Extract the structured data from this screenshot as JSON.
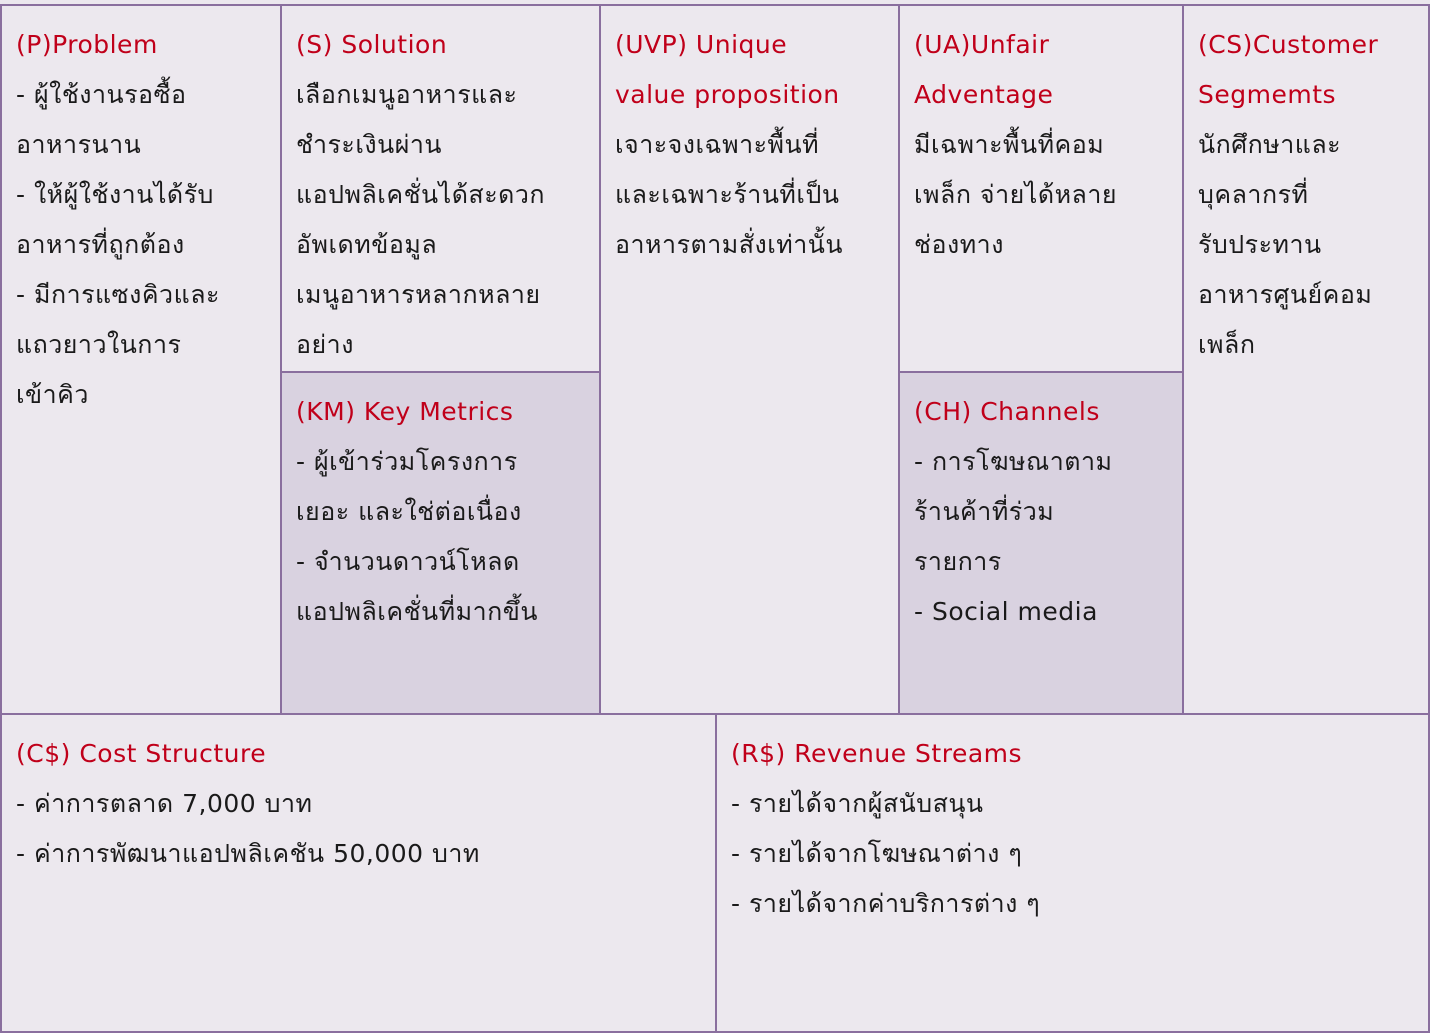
{
  "problem": {
    "title": "(P)Problem",
    "lines": [
      "- ผู้ใช้งานรอซื้อ",
      "อาหารนาน",
      "- ให้ผู้ใช้งานได้รับ",
      "อาหารที่ถูกต้อง",
      "- มีการแซงคิวและ",
      "แถวยาวในการ",
      "เข้าคิว"
    ]
  },
  "solution": {
    "title": "(S) Solution",
    "lines": [
      "เลือกเมนูอาหารและ",
      "ชำระเงินผ่าน",
      "แอปพลิเคชั่นได้สะดวก",
      "อัพเดทข้อมูล",
      "เมนูอาหารหลากหลาย",
      "อย่าง"
    ]
  },
  "key_metrics": {
    "title": "(KM) Key Metrics",
    "lines": [
      "- ผู้เข้าร่วมโครงการ",
      "เยอะ และใช่ต่อเนื่อง",
      "- จำนวนดาวน์โหลด",
      "แอปพลิเคชั่นที่มากขึ้น"
    ]
  },
  "uvp": {
    "title_lines": [
      "(UVP) Unique",
      "value proposition"
    ],
    "lines": [
      "เจาะจงเฉพาะพื้นที่",
      "และเฉพาะร้านที่เป็น",
      "อาหารตามสั่งเท่านั้น"
    ]
  },
  "unfair_advantage": {
    "title_lines": [
      "(UA)Unfair",
      "Adventage"
    ],
    "lines": [
      "มีเฉพาะพื้นที่คอม",
      "เพล็ก จ่ายได้หลาย",
      "ช่องทาง"
    ]
  },
  "channels": {
    "title": "(CH) Channels",
    "lines": [
      "- การโฆษณาตาม",
      "ร้านค้าที่ร่วม",
      "รายการ",
      "- Social media"
    ]
  },
  "customer_segments": {
    "title_lines": [
      "(CS)Customer",
      "Segmemts"
    ],
    "lines": [
      "นักศึกษาและ",
      "บุคลากรที่",
      "รับประทาน",
      "อาหารศูนย์คอม",
      "เพล็ก"
    ]
  },
  "cost_structure": {
    "title": "(C$) Cost Structure",
    "lines": [
      "- ค่าการตลาด 7,000 บาท",
      "- ค่าการพัฒนาแอปพลิเคชัน 50,000 บาท"
    ]
  },
  "revenue_streams": {
    "title": "(R$) Revenue Streams",
    "lines": [
      "- รายได้จากผู้สนับสนุน",
      "- รายได้จากโฆษณาต่าง ๆ",
      "- รายได้จากค่าบริการต่าง ๆ"
    ]
  },
  "colors": {
    "title_red": "#c0001a",
    "border": "#8a6f9e",
    "bg_light": "#ece8ee",
    "bg_shade": "#d9d2e0"
  }
}
